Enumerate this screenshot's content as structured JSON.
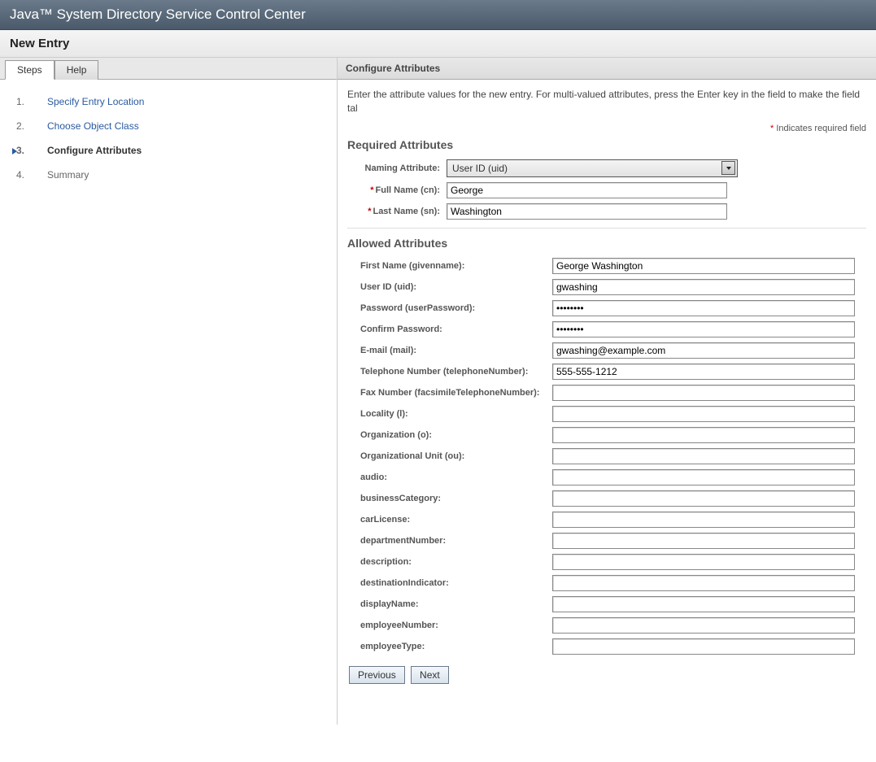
{
  "header": {
    "title": "Java™ System Directory Service Control Center",
    "subtitle": "New Entry"
  },
  "tabs": {
    "steps": "Steps",
    "help": "Help"
  },
  "steps": [
    {
      "num": "1.",
      "label": "Specify Entry Location",
      "kind": "link"
    },
    {
      "num": "2.",
      "label": "Choose Object Class",
      "kind": "link"
    },
    {
      "num": "3.",
      "label": "Configure Attributes",
      "kind": "current"
    },
    {
      "num": "4.",
      "label": "Summary",
      "kind": "plain"
    }
  ],
  "panel": {
    "title": "Configure Attributes",
    "instructions": "Enter the attribute values for the new entry. For multi-valued attributes, press the Enter key in the field to make the field tal",
    "required_note_prefix": "*",
    "required_note_text": " Indicates required field"
  },
  "required": {
    "section": "Required Attributes",
    "naming_label": "Naming Attribute:",
    "naming_value": "User ID (uid)",
    "fullname_label": "Full Name (cn):",
    "fullname_value": "George",
    "lastname_label": "Last Name (sn):",
    "lastname_value": "Washington"
  },
  "allowed": {
    "section": "Allowed Attributes",
    "fields": [
      {
        "label": "First Name (givenname):",
        "value": "George Washington"
      },
      {
        "label": "User ID (uid):",
        "value": "gwashing"
      },
      {
        "label": "Password (userPassword):",
        "value": "********",
        "type": "password"
      },
      {
        "label": "Confirm Password:",
        "value": "********",
        "type": "password"
      },
      {
        "label": "E-mail (mail):",
        "value": "gwashing@example.com"
      },
      {
        "label": "Telephone Number (telephoneNumber):",
        "value": "555-555-1212"
      },
      {
        "label": "Fax Number (facsimileTelephoneNumber):",
        "value": ""
      },
      {
        "label": "Locality (l):",
        "value": ""
      },
      {
        "label": "Organization (o):",
        "value": ""
      },
      {
        "label": "Organizational Unit (ou):",
        "value": ""
      },
      {
        "label": "audio:",
        "value": ""
      },
      {
        "label": "businessCategory:",
        "value": ""
      },
      {
        "label": "carLicense:",
        "value": ""
      },
      {
        "label": "departmentNumber:",
        "value": ""
      },
      {
        "label": "description:",
        "value": ""
      },
      {
        "label": "destinationIndicator:",
        "value": ""
      },
      {
        "label": "displayName:",
        "value": ""
      },
      {
        "label": "employeeNumber:",
        "value": ""
      },
      {
        "label": "employeeType:",
        "value": ""
      }
    ]
  },
  "buttons": {
    "previous": "Previous",
    "next": "Next"
  }
}
